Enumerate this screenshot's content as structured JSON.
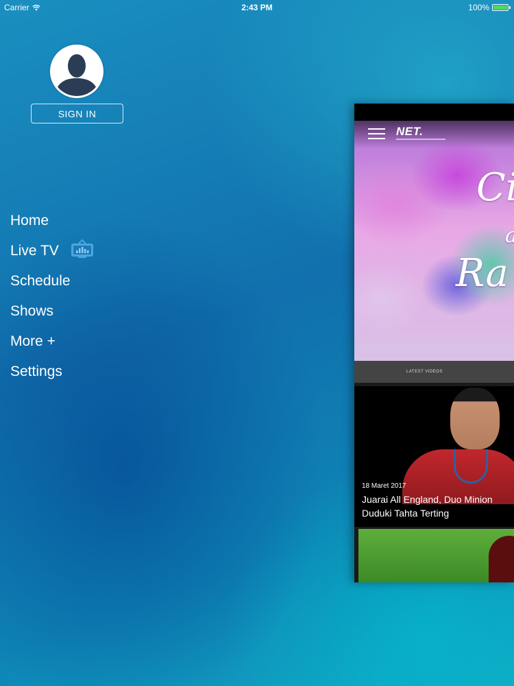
{
  "status_bar": {
    "carrier": "Carrier",
    "time": "2:43 PM",
    "battery": "100%"
  },
  "profile": {
    "sign_in_label": "SIGN IN"
  },
  "menu": {
    "items": [
      {
        "label": "Home"
      },
      {
        "label": "Live TV"
      },
      {
        "label": "Schedule"
      },
      {
        "label": "Shows"
      },
      {
        "label": "More +"
      },
      {
        "label": "Settings"
      }
    ]
  },
  "preview": {
    "logo": "NET.",
    "hero_text": [
      "Ci",
      "a",
      "Ra"
    ],
    "latest_label": "LATEST VIDEOS",
    "videos": [
      {
        "date": "18 Maret 2017",
        "title_line1": "Juarai All England, Duo Minion",
        "title_line2": "Duduki Tahta Terting"
      }
    ]
  },
  "colors": {
    "accent": "#4aa8e0",
    "battery": "#4cd964"
  },
  "icons": [
    "wifi-icon",
    "battery-icon",
    "avatar-icon",
    "live-tv-icon",
    "hamburger-icon"
  ]
}
